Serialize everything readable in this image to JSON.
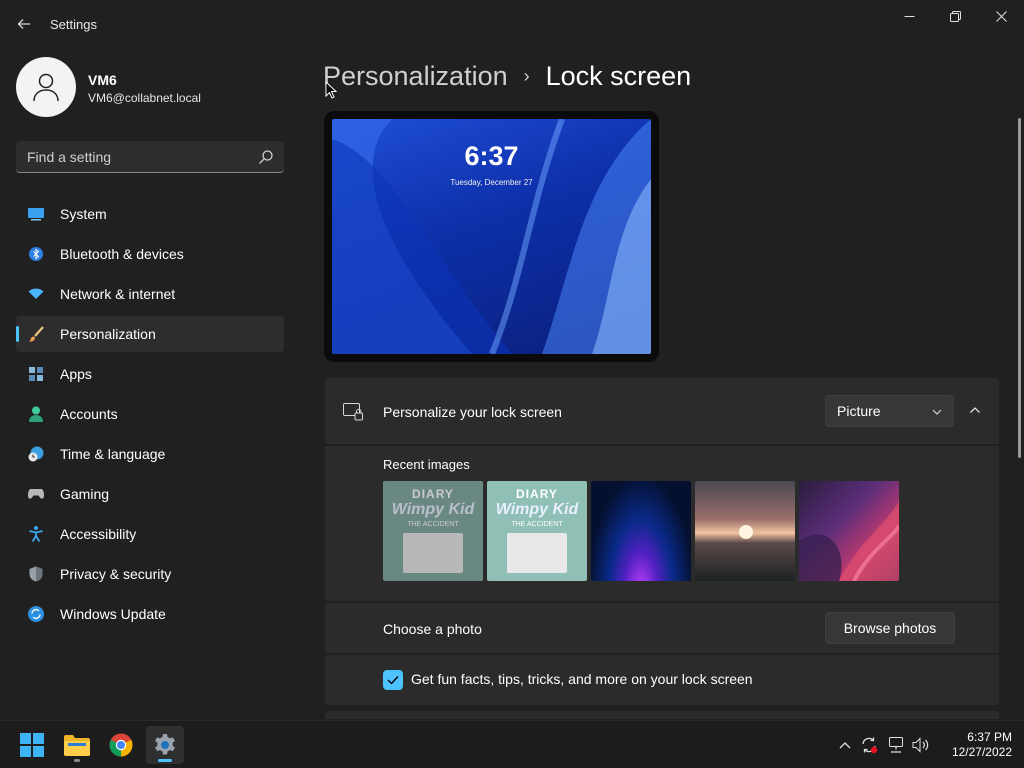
{
  "window": {
    "title": "Settings",
    "controls": {
      "minimize": "minimize",
      "maximize": "restore",
      "close": "close"
    }
  },
  "profile": {
    "name": "VM6",
    "email": "VM6@collabnet.local"
  },
  "search": {
    "placeholder": "Find a setting",
    "icon": "search-icon"
  },
  "sidebar": {
    "items": [
      {
        "label": "System",
        "icon": "system-icon",
        "active": false
      },
      {
        "label": "Bluetooth & devices",
        "icon": "bluetooth-icon",
        "active": false
      },
      {
        "label": "Network & internet",
        "icon": "wifi-icon",
        "active": false
      },
      {
        "label": "Personalization",
        "icon": "brush-icon",
        "active": true
      },
      {
        "label": "Apps",
        "icon": "apps-icon",
        "active": false
      },
      {
        "label": "Accounts",
        "icon": "person-icon",
        "active": false
      },
      {
        "label": "Time & language",
        "icon": "clock-globe-icon",
        "active": false
      },
      {
        "label": "Gaming",
        "icon": "controller-icon",
        "active": false
      },
      {
        "label": "Accessibility",
        "icon": "accessibility-icon",
        "active": false
      },
      {
        "label": "Privacy & security",
        "icon": "shield-icon",
        "active": false
      },
      {
        "label": "Windows Update",
        "icon": "update-icon",
        "active": false
      }
    ],
    "accent": "#4cc2ff"
  },
  "breadcrumb": {
    "parent": "Personalization",
    "separator": "›",
    "current": "Lock screen"
  },
  "preview": {
    "time": "6:37",
    "date": "Tuesday, December 27"
  },
  "personalize": {
    "title": "Personalize your lock screen",
    "dropdown_value": "Picture",
    "recent_label": "Recent images",
    "thumbnails": [
      {
        "name": "diary-wimpy-kid-cover-faded",
        "book_title": "DIARY",
        "book_title2": "Wimpy Kid",
        "book_sub": "THE ACCIDENT"
      },
      {
        "name": "diary-wimpy-kid-cover",
        "book_title": "DIARY",
        "book_title2": "Wimpy Kid",
        "book_sub": "THE ACCIDENT"
      },
      {
        "name": "blue-glow-wallpaper"
      },
      {
        "name": "sunset-lake-wallpaper"
      },
      {
        "name": "purple-swirl-wallpaper"
      }
    ],
    "choose_label": "Choose a photo",
    "browse_button": "Browse photos",
    "tips_label": "Get fun facts, tips, tricks, and more on your lock screen",
    "tips_checked": true
  },
  "taskbar": {
    "apps": [
      {
        "name": "start-button",
        "icon": "windows-logo-icon"
      },
      {
        "name": "file-explorer",
        "icon": "folder-icon"
      },
      {
        "name": "chrome",
        "icon": "chrome-icon"
      },
      {
        "name": "settings",
        "icon": "gear-icon",
        "active": true
      }
    ],
    "tray": [
      "chevron-up-icon",
      "sync-icon",
      "network-icon",
      "volume-icon"
    ],
    "time": "6:37 PM",
    "date": "12/27/2022"
  }
}
